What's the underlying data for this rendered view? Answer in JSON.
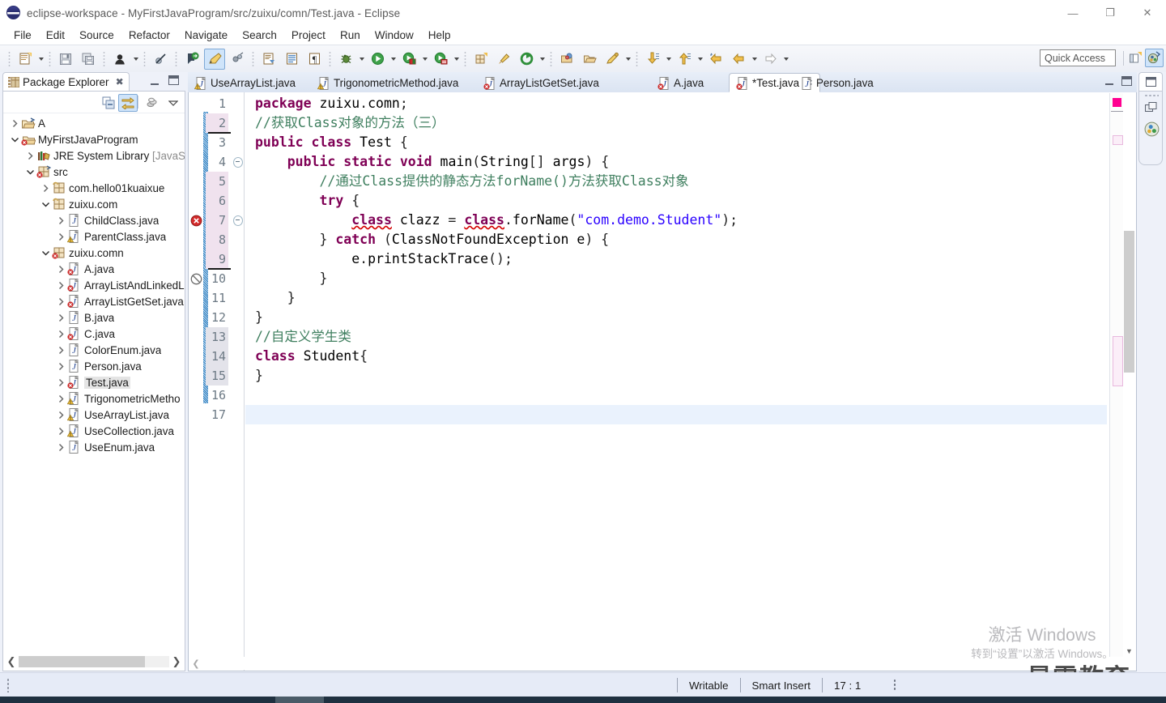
{
  "window": {
    "title": "eclipse-workspace - MyFirstJavaProgram/src/zuixu/comn/Test.java - Eclipse",
    "icon": "eclipse-icon",
    "minimize": "—",
    "maximize": "❐",
    "close": "✕"
  },
  "menubar": {
    "items": [
      "File",
      "Edit",
      "Source",
      "Refactor",
      "Navigate",
      "Search",
      "Project",
      "Run",
      "Window",
      "Help"
    ]
  },
  "toolbar": {
    "quick_access": "Quick Access",
    "buttons": [
      "new-wizard-icon",
      "save-icon",
      "save-all-icon",
      "person-icon",
      "skip-breakpoints-icon",
      "annotation-icon",
      "edit-pencil-icon",
      "next-annotation-icon",
      "open-task-icon",
      "open-console-icon",
      "paragraph-icon",
      "debug-icon",
      "run-icon",
      "coverage-icon",
      "profile-icon",
      "new-package-icon",
      "external-tools-icon",
      "open-type-icon",
      "open-folder-icon",
      "search-icon",
      "next-edit-icon",
      "previous-edit-icon",
      "back-icon",
      "forward-icon"
    ],
    "perspective_open": "open-perspective-icon",
    "perspective_java": "java-perspective-icon"
  },
  "package_explorer": {
    "title": "Package Explorer",
    "close_label": "✖",
    "toolbar": [
      "collapse-all-icon",
      "link-with-editor-icon",
      "view-menu-icon",
      "view-dropdown-icon"
    ],
    "tree": [
      {
        "indent": 0,
        "label": "A",
        "suffix": "",
        "twisty": "right",
        "icon": "project-closed-icon"
      },
      {
        "indent": 0,
        "label": "MyFirstJavaProgram",
        "suffix": "",
        "twisty": "down",
        "icon": "project-error-icon"
      },
      {
        "indent": 1,
        "label": "JRE System Library",
        "suffix": " [JavaSE-",
        "twisty": "right",
        "icon": "library-icon"
      },
      {
        "indent": 1,
        "label": "src",
        "suffix": "",
        "twisty": "down",
        "icon": "source-folder-error-icon"
      },
      {
        "indent": 2,
        "label": "com.hello01kuaixue",
        "suffix": "",
        "twisty": "right",
        "icon": "package-icon"
      },
      {
        "indent": 2,
        "label": "zuixu.com",
        "suffix": "",
        "twisty": "down",
        "icon": "package-icon"
      },
      {
        "indent": 3,
        "label": "ChildClass.java",
        "suffix": "",
        "twisty": "right",
        "icon": "java-file-icon"
      },
      {
        "indent": 3,
        "label": "ParentClass.java",
        "suffix": "",
        "twisty": "right",
        "icon": "java-warning-icon"
      },
      {
        "indent": 2,
        "label": "zuixu.comn",
        "suffix": "",
        "twisty": "down",
        "icon": "package-error-icon"
      },
      {
        "indent": 3,
        "label": "A.java",
        "suffix": "",
        "twisty": "right",
        "icon": "java-error-icon"
      },
      {
        "indent": 3,
        "label": "ArrayListAndLinkedLi",
        "suffix": "",
        "twisty": "right",
        "icon": "java-error-icon"
      },
      {
        "indent": 3,
        "label": "ArrayListGetSet.java",
        "suffix": "",
        "twisty": "right",
        "icon": "java-error-icon"
      },
      {
        "indent": 3,
        "label": "B.java",
        "suffix": "",
        "twisty": "right",
        "icon": "java-file-icon"
      },
      {
        "indent": 3,
        "label": "C.java",
        "suffix": "",
        "twisty": "right",
        "icon": "java-error-icon"
      },
      {
        "indent": 3,
        "label": "ColorEnum.java",
        "suffix": "",
        "twisty": "right",
        "icon": "java-file-icon"
      },
      {
        "indent": 3,
        "label": "Person.java",
        "suffix": "",
        "twisty": "right",
        "icon": "java-file-icon"
      },
      {
        "indent": 3,
        "label": "Test.java",
        "suffix": "",
        "twisty": "right",
        "icon": "java-error-icon",
        "selected": true
      },
      {
        "indent": 3,
        "label": "TrigonometricMetho",
        "suffix": "",
        "twisty": "right",
        "icon": "java-warning-icon"
      },
      {
        "indent": 3,
        "label": "UseArrayList.java",
        "suffix": "",
        "twisty": "right",
        "icon": "java-warning-icon"
      },
      {
        "indent": 3,
        "label": "UseCollection.java",
        "suffix": "",
        "twisty": "right",
        "icon": "java-warning-icon"
      },
      {
        "indent": 3,
        "label": "UseEnum.java",
        "suffix": "",
        "twisty": "right",
        "icon": "java-file-icon"
      }
    ]
  },
  "editor": {
    "tabs": [
      {
        "label": "UseArrayList.java",
        "icon": "java-warning-icon",
        "active": false,
        "dirty": false
      },
      {
        "label": "TrigonometricMethod.java",
        "icon": "java-warning-icon",
        "active": false,
        "dirty": false
      },
      {
        "label": "ArrayListGetSet.java",
        "icon": "java-error-icon",
        "active": false,
        "dirty": false
      },
      {
        "label": "A.java",
        "icon": "java-error-icon",
        "active": false,
        "dirty": false
      },
      {
        "label": "*Test.java",
        "icon": "java-error-icon",
        "active": true,
        "dirty": true,
        "close": "✖"
      },
      {
        "label": "Person.java",
        "icon": "java-file-icon",
        "active": false,
        "dirty": false
      }
    ],
    "minimize": "—",
    "maximize": "❐",
    "lines": [
      {
        "n": 1,
        "hl": "none"
      },
      {
        "n": 2,
        "hl": "pink"
      },
      {
        "n": 3,
        "hl": "none"
      },
      {
        "n": 4,
        "hl": "none",
        "fold": true
      },
      {
        "n": 5,
        "hl": "pink"
      },
      {
        "n": 6,
        "hl": "pink"
      },
      {
        "n": 7,
        "hl": "pink",
        "fold": true,
        "marker": "error"
      },
      {
        "n": 8,
        "hl": "pink"
      },
      {
        "n": 9,
        "hl": "pink"
      },
      {
        "n": 10,
        "hl": "none",
        "marker": "quickfix"
      },
      {
        "n": 11,
        "hl": "none"
      },
      {
        "n": 12,
        "hl": "none"
      },
      {
        "n": 13,
        "hl": "gray"
      },
      {
        "n": 14,
        "hl": "gray"
      },
      {
        "n": 15,
        "hl": "gray"
      },
      {
        "n": 16,
        "hl": "none"
      },
      {
        "n": 17,
        "hl": "none",
        "caret": true
      }
    ],
    "code_text": [
      "package zuixu.comn;",
      "//获取Class对象的方法（三）",
      "public class Test {",
      "    public static void main(String[] args) {",
      "        //通过Class提供的静态方法forName()方法获取Class对象",
      "        try {",
      "            class clazz = class.forName(\"com.demo.Student\");",
      "        } catch (ClassNotFoundException e) {",
      "            e.printStackTrace();",
      "        }",
      "    }",
      "}",
      "//自定义学生类",
      "class Student{",
      "}",
      "",
      ""
    ]
  },
  "status_bar": {
    "writable": "Writable",
    "insert_mode": "Smart Insert",
    "position": "17 : 1"
  },
  "watermark": {
    "line1": "激活 Windows",
    "line2": "转到“设置”以激活 Windows。",
    "brand": "最需教育"
  },
  "colors": {
    "keyword": "#7f0055",
    "comment": "#3f7f5f",
    "string": "#2a00ff",
    "error_underline": "#d40000",
    "accent": "#cfe4fa"
  }
}
